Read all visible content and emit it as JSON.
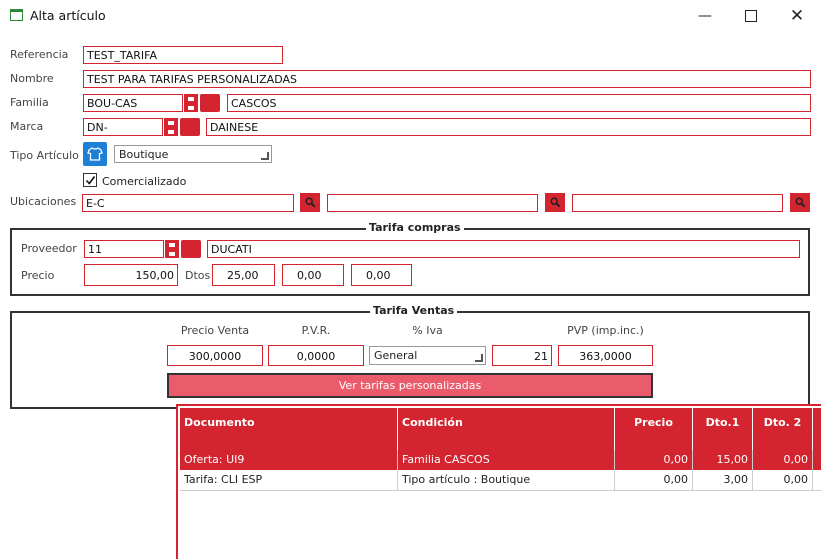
{
  "window": {
    "title": "Alta artículo"
  },
  "form": {
    "referencia_label": "Referencia",
    "referencia": "TEST_TARIFA",
    "nombre_label": "Nombre",
    "nombre": "TEST PARA TARIFAS PERSONALIZADAS",
    "familia_label": "Familia",
    "familia_code": "BOU-CAS",
    "familia_desc": "CASCOS",
    "marca_label": "Marca",
    "marca_code": "DN-",
    "marca_desc": "DAINESE",
    "tipo_label": "Tipo Artículo",
    "tipo_value": "Boutique",
    "comercializado_label": "Comercializado",
    "comercializado_checked": true,
    "ubicaciones_label": "Ubicaciones",
    "ubicacion1": "E-C",
    "ubicacion2": "",
    "ubicacion3": ""
  },
  "compras": {
    "title": "Tarifa compras",
    "proveedor_label": "Proveedor",
    "proveedor_code": "11",
    "proveedor_desc": "DUCATI",
    "precio_label": "Precio",
    "precio": "150,00",
    "dtos_label": "Dtos",
    "dto1": "25,00",
    "dto2": "0,00",
    "dto3": "0,00"
  },
  "ventas": {
    "title": "Tarifa Ventas",
    "precio_venta_label": "Precio Venta",
    "precio_venta": "300,0000",
    "pvr_label": "P.V.R.",
    "pvr": "0,0000",
    "iva_label": "% Iva",
    "iva_type": "General",
    "iva_value": "21",
    "pvp_label": "PVP (imp.inc.)",
    "pvp": "363,0000",
    "btn_tarifas": "Ver tarifas personalizadas"
  },
  "grid": {
    "headers": [
      "Documento",
      "Condición",
      "Precio",
      "Dto.1",
      "Dto. 2"
    ],
    "rows": [
      [
        "Oferta: UI9",
        "Familia CASCOS",
        "0,00",
        "15,00",
        "0,00"
      ],
      [
        "Tarifa: CLI ESP",
        "Tipo artículo : Boutique",
        "0,00",
        "3,00",
        "0,00"
      ]
    ]
  },
  "colors": {
    "accent": "#d4242f",
    "button": "#ea5b6c",
    "tipo_icon": "#1e7fd6"
  },
  "icons": [
    "window-icon",
    "minimize-icon",
    "maximize-icon",
    "close-icon",
    "shirt-icon",
    "search-icon",
    "check-icon"
  ]
}
